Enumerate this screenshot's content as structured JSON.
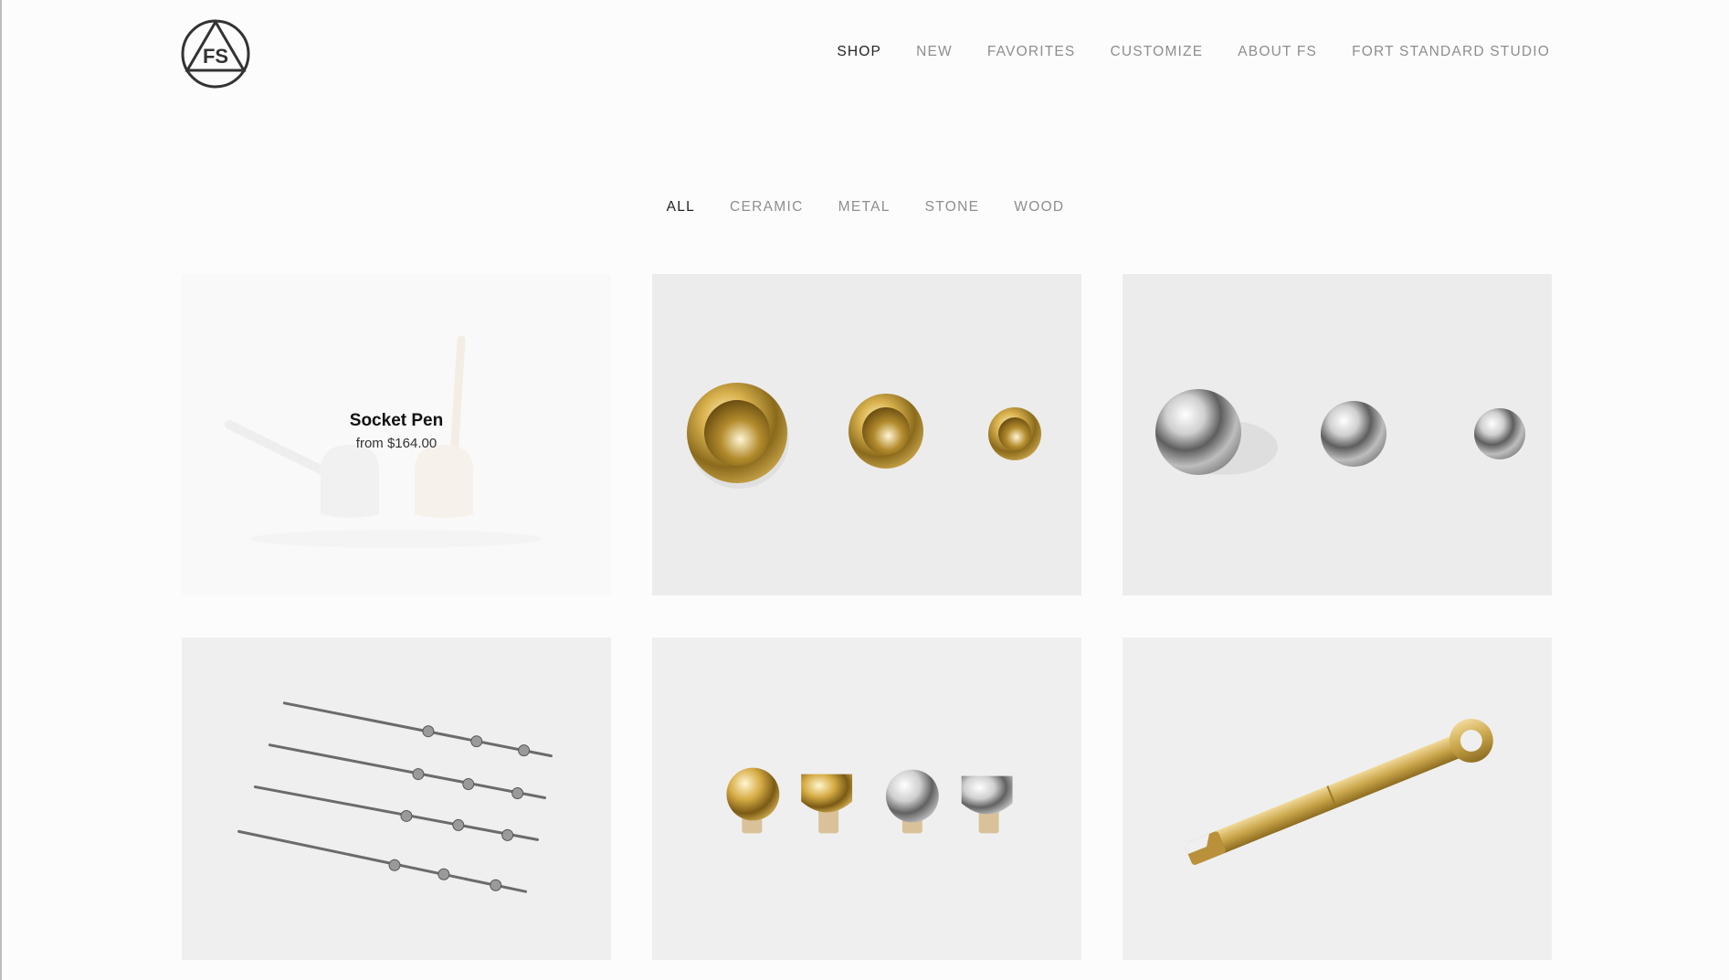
{
  "brand": {
    "logo_text": "FS",
    "logo_icon": "triangle-in-circle-icon"
  },
  "nav": {
    "items": [
      {
        "label": "SHOP",
        "active": true
      },
      {
        "label": "NEW",
        "active": false
      },
      {
        "label": "FAVORITES",
        "active": false
      },
      {
        "label": "CUSTOMIZE",
        "active": false
      },
      {
        "label": "ABOUT FS",
        "active": false
      },
      {
        "label": "FORT STANDARD STUDIO",
        "active": false
      }
    ]
  },
  "filters": {
    "items": [
      {
        "label": "ALL",
        "active": true
      },
      {
        "label": "CERAMIC",
        "active": false
      },
      {
        "label": "METAL",
        "active": false
      },
      {
        "label": "STONE",
        "active": false
      },
      {
        "label": "WOOD",
        "active": false
      }
    ]
  },
  "products": [
    {
      "image": "socket-pen-image",
      "hover_title": "Socket Pen",
      "hover_price": "from $164.00"
    },
    {
      "image": "brass-bowls-image"
    },
    {
      "image": "silver-spheres-image"
    },
    {
      "image": "cocktail-picks-image"
    },
    {
      "image": "bottle-stoppers-image"
    },
    {
      "image": "brass-bottle-opener-image"
    }
  ],
  "colors": {
    "background": "#fcfcfc",
    "text_active": "#222222",
    "text_muted": "#8e8e8e",
    "tile_bg": "#efefef",
    "brass": "#c9a54a",
    "silver": "#b8b8b8"
  }
}
